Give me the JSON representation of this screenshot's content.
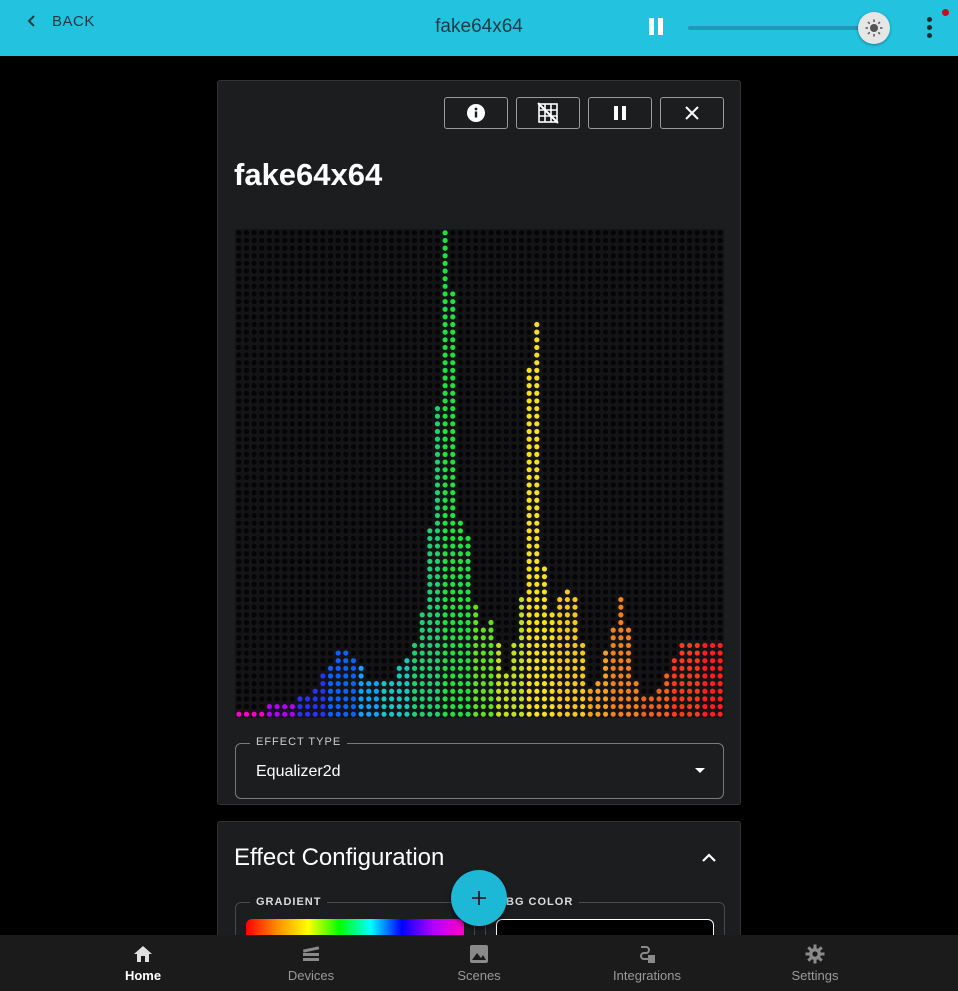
{
  "appbar": {
    "back_label": "BACK",
    "title": "fake64x64",
    "brightness": 0.92
  },
  "device": {
    "title": "fake64x64",
    "matrix": {
      "cols": 64,
      "rows": 64,
      "bar_heights": [
        1,
        1,
        1,
        1,
        1,
        2,
        2,
        2,
        2,
        2,
        2,
        3,
        3,
        3,
        4,
        5,
        6,
        7,
        8,
        9,
        9,
        9,
        8,
        7,
        6,
        5,
        5,
        5,
        5,
        5,
        6,
        7,
        8,
        8,
        10,
        14,
        18,
        25,
        41,
        55,
        64,
        56,
        42,
        26,
        24,
        22,
        15,
        12,
        13,
        13,
        10,
        6,
        6,
        10,
        16,
        40,
        46,
        52,
        37,
        20,
        14,
        16,
        16,
        17,
        17,
        16,
        10,
        5,
        4,
        5,
        6,
        9,
        12,
        14,
        16,
        12,
        7,
        5,
        3,
        2,
        3,
        4,
        5,
        6,
        8,
        10,
        10,
        10,
        10,
        10,
        10,
        10,
        10,
        10,
        10
      ],
      "colors": [
        "#ff00c8",
        "#b000ff",
        "#2a30ff",
        "#1060ff",
        "#10a0ff",
        "#18c8c0",
        "#20d070",
        "#22e040",
        "#60e020",
        "#c0e020",
        "#f6e020",
        "#f5c820",
        "#f5a020",
        "#f08020",
        "#f06020",
        "#ff3a20",
        "#ff2020"
      ]
    },
    "effect_type": {
      "label": "EFFECT TYPE",
      "value": "Equalizer2d"
    }
  },
  "effect_config": {
    "title": "Effect Configuration",
    "gradient_label": "GRADIENT",
    "bg_color_label": "BG COLOR",
    "bg_color": "#000000"
  },
  "nav": {
    "items": [
      {
        "label": "Home",
        "icon": "home-icon",
        "active": true
      },
      {
        "label": "Devices",
        "icon": "devices-icon"
      },
      {
        "label": "Scenes",
        "icon": "scenes-icon"
      },
      {
        "label": "Integrations",
        "icon": "integrations-icon"
      },
      {
        "label": "Settings",
        "icon": "gear-icon"
      }
    ]
  },
  "colors": {
    "accent": "#23c3e0",
    "fab": "#1cb8d6",
    "card": "#1c1d1f"
  }
}
